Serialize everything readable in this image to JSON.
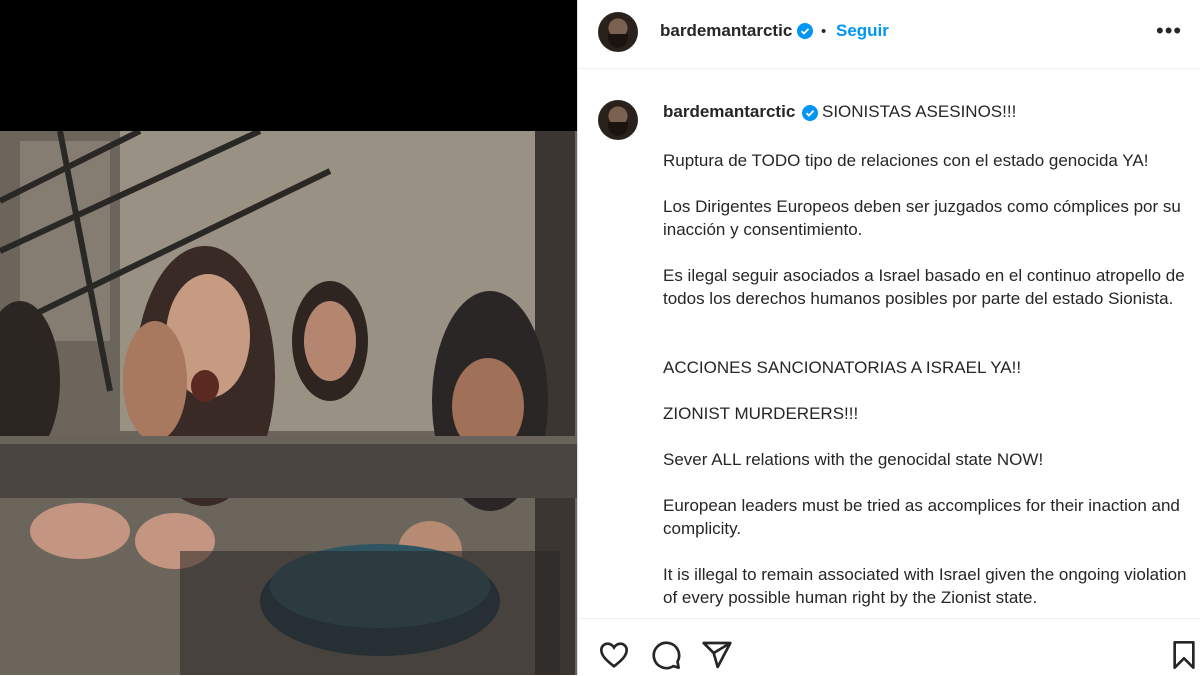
{
  "post": {
    "username": "bardemantarctic",
    "follow_label": "Seguir",
    "separator": "•",
    "more_label": "•••",
    "image_alt": "Photo of women and girls reaching out with pots behind a metal barrier",
    "caption_title": "SIONISTAS ASESINOS!!!",
    "caption_paragraphs": [
      "Ruptura de TODO tipo de relaciones con el estado genocida YA!",
      "Los Dirigentes Europeos deben ser juzgados como cómplices por su inacción y consentimiento.",
      "Es ilegal seguir asociados a Israel basado en el continuo atropello de todos los derechos humanos posibles por parte del estado Sionista.",
      "ACCIONES SANCIONATORIAS A ISRAEL YA!!",
      "ZIONIST MURDERERS!!!",
      "Sever ALL relations with the genocidal state NOW!",
      "European leaders must be tried as accomplices for their inaction and complicity.",
      "It is illegal to remain associated with Israel given the ongoing violation of every possible human right by the Zionist state."
    ]
  },
  "icons": {
    "verified": "verified-badge-icon",
    "like": "heart-icon",
    "comment": "comment-icon",
    "share": "paper-plane-icon",
    "save": "bookmark-icon"
  },
  "colors": {
    "accent": "#0095f6",
    "text": "#262626",
    "verified": "#0095f6"
  }
}
